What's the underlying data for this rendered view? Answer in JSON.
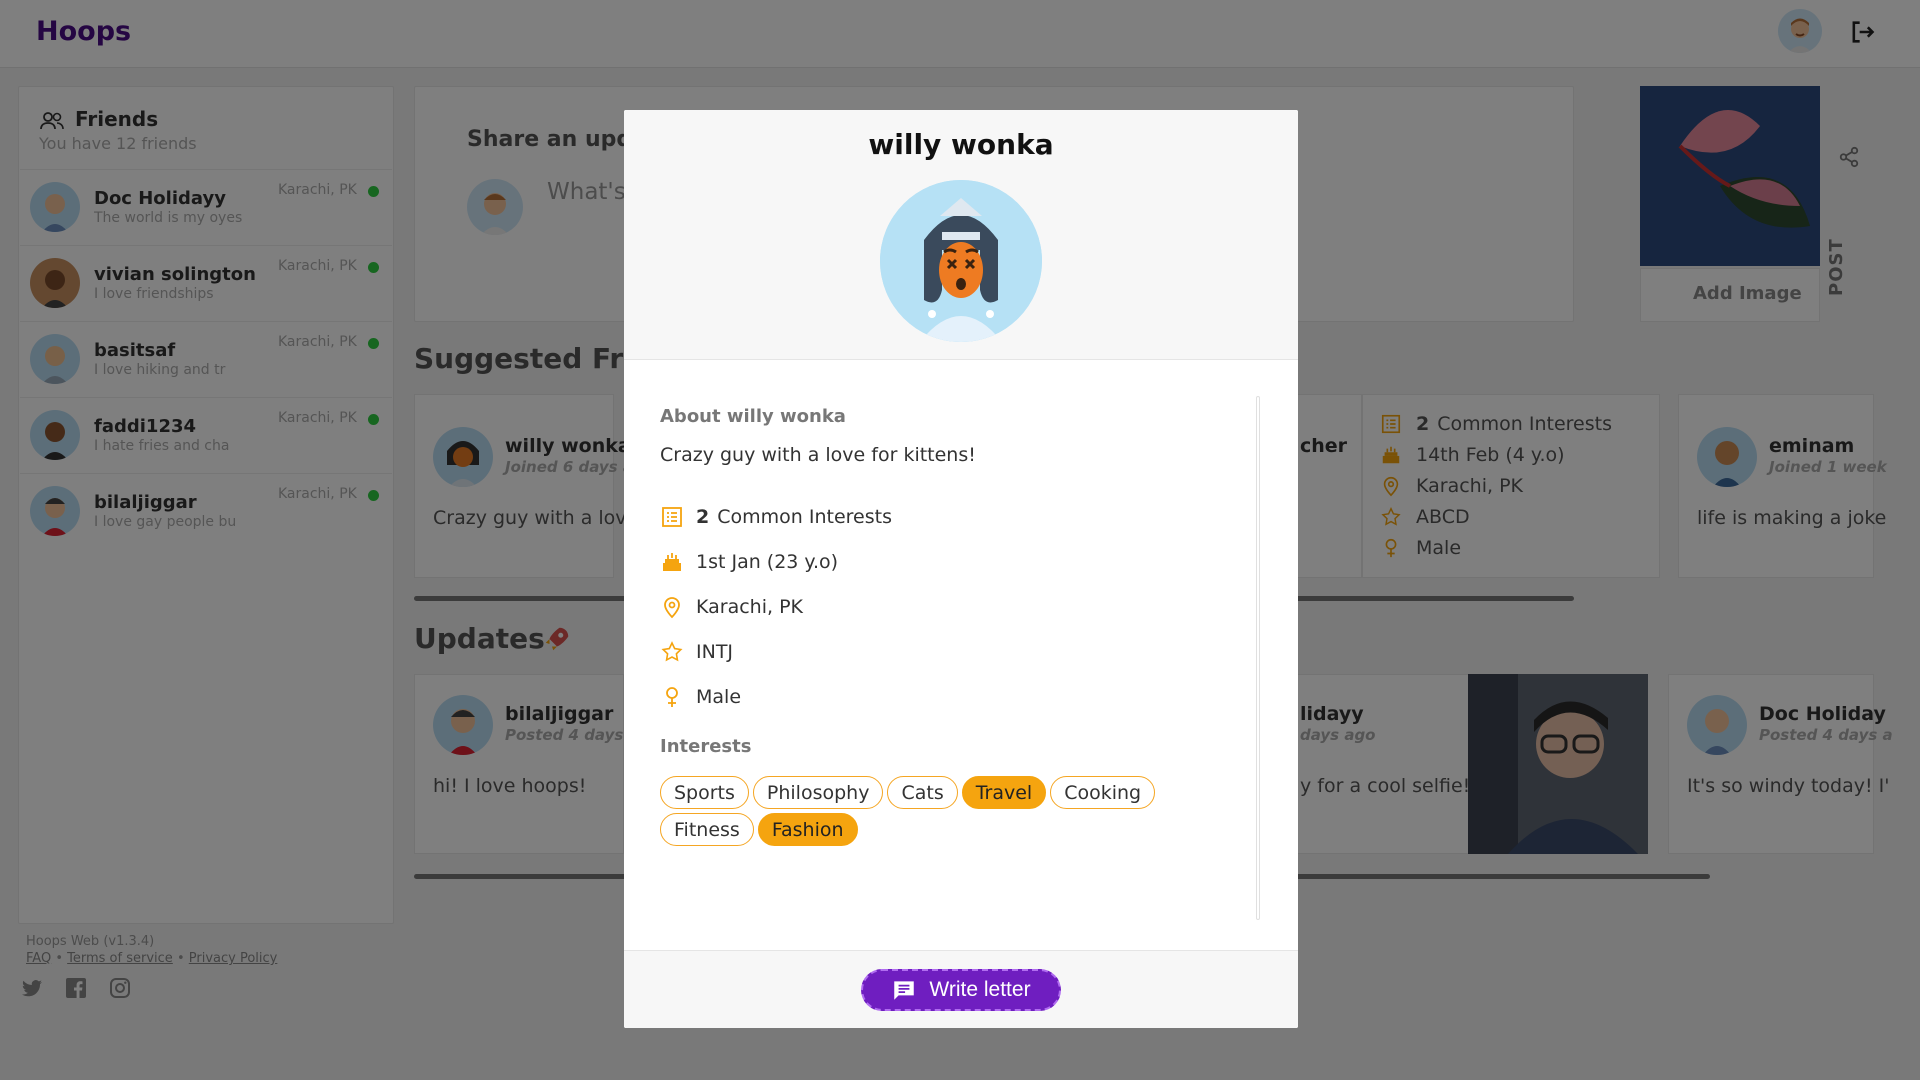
{
  "header": {
    "brand": "Hoops"
  },
  "friends": {
    "title": "Friends",
    "subtitle": "You have 12 friends",
    "items": [
      {
        "name": "Doc Holidayy",
        "status": "The world is my oyes",
        "location": "Karachi, PK"
      },
      {
        "name": "vivian solington",
        "status": "I love friendships",
        "location": "Karachi, PK"
      },
      {
        "name": "basitsaf",
        "status": "I love hiking and tr",
        "location": "Karachi, PK"
      },
      {
        "name": "faddi1234",
        "status": "I hate fries and cha",
        "location": "Karachi, PK"
      },
      {
        "name": "bilaljiggar",
        "status": "I love gay people bu",
        "location": "Karachi, PK"
      }
    ]
  },
  "footer": {
    "version": "Hoops Web (v1.3.4)",
    "faq": "FAQ",
    "sep": "•",
    "terms": "Terms of service",
    "privacy": "Privacy Policy"
  },
  "share": {
    "title": "Share an upda",
    "placeholder": "What's",
    "add_image": "Add Image",
    "post": "POST"
  },
  "suggested": {
    "title": "Suggested Frie",
    "cards": [
      {
        "name": "willy wonka",
        "joined": "Joined 6 days a",
        "text": "Crazy guy with a love"
      },
      {
        "name": "eminam",
        "joined": "Joined 1 week",
        "text": "life is making a joke"
      }
    ],
    "partial_name": "cher",
    "meta": {
      "interests_count": "2",
      "interests_label": "Common Interests",
      "birthday": "14th Feb (4 y.o)",
      "location": "Karachi, PK",
      "personality": "ABCD",
      "gender": "Male"
    }
  },
  "updates": {
    "title": "Updates",
    "posts": [
      {
        "name": "bilaljiggar",
        "time": "Posted 4 days a",
        "text": "hi! I love hoops!"
      },
      {
        "name": "lidayy",
        "time": "days ago",
        "text": "y for a cool selfie!"
      },
      {
        "name": "Doc Holiday",
        "time": "Posted 4 days a",
        "text": "It's so windy today! I'"
      }
    ]
  },
  "modal": {
    "name": "willy wonka",
    "about_title": "About willy wonka",
    "about_text": "Crazy guy with a love for kittens!",
    "interests_count": "2",
    "interests_label": "Common Interests",
    "birthday": "1st Jan (23 y.o)",
    "location": "Karachi, PK",
    "personality": "INTJ",
    "gender": "Male",
    "interests_title": "Interests",
    "interests": [
      {
        "label": "Sports",
        "common": false
      },
      {
        "label": "Philosophy",
        "common": false
      },
      {
        "label": "Cats",
        "common": false
      },
      {
        "label": "Travel",
        "common": true
      },
      {
        "label": "Cooking",
        "common": false
      },
      {
        "label": "Fitness",
        "common": false
      },
      {
        "label": "Fashion",
        "common": true
      }
    ],
    "write_letter": "Write letter"
  },
  "colors": {
    "brand": "#4b0d86",
    "accent": "#f5a40f",
    "button": "#6f1ec0",
    "online": "#2ecc40"
  }
}
